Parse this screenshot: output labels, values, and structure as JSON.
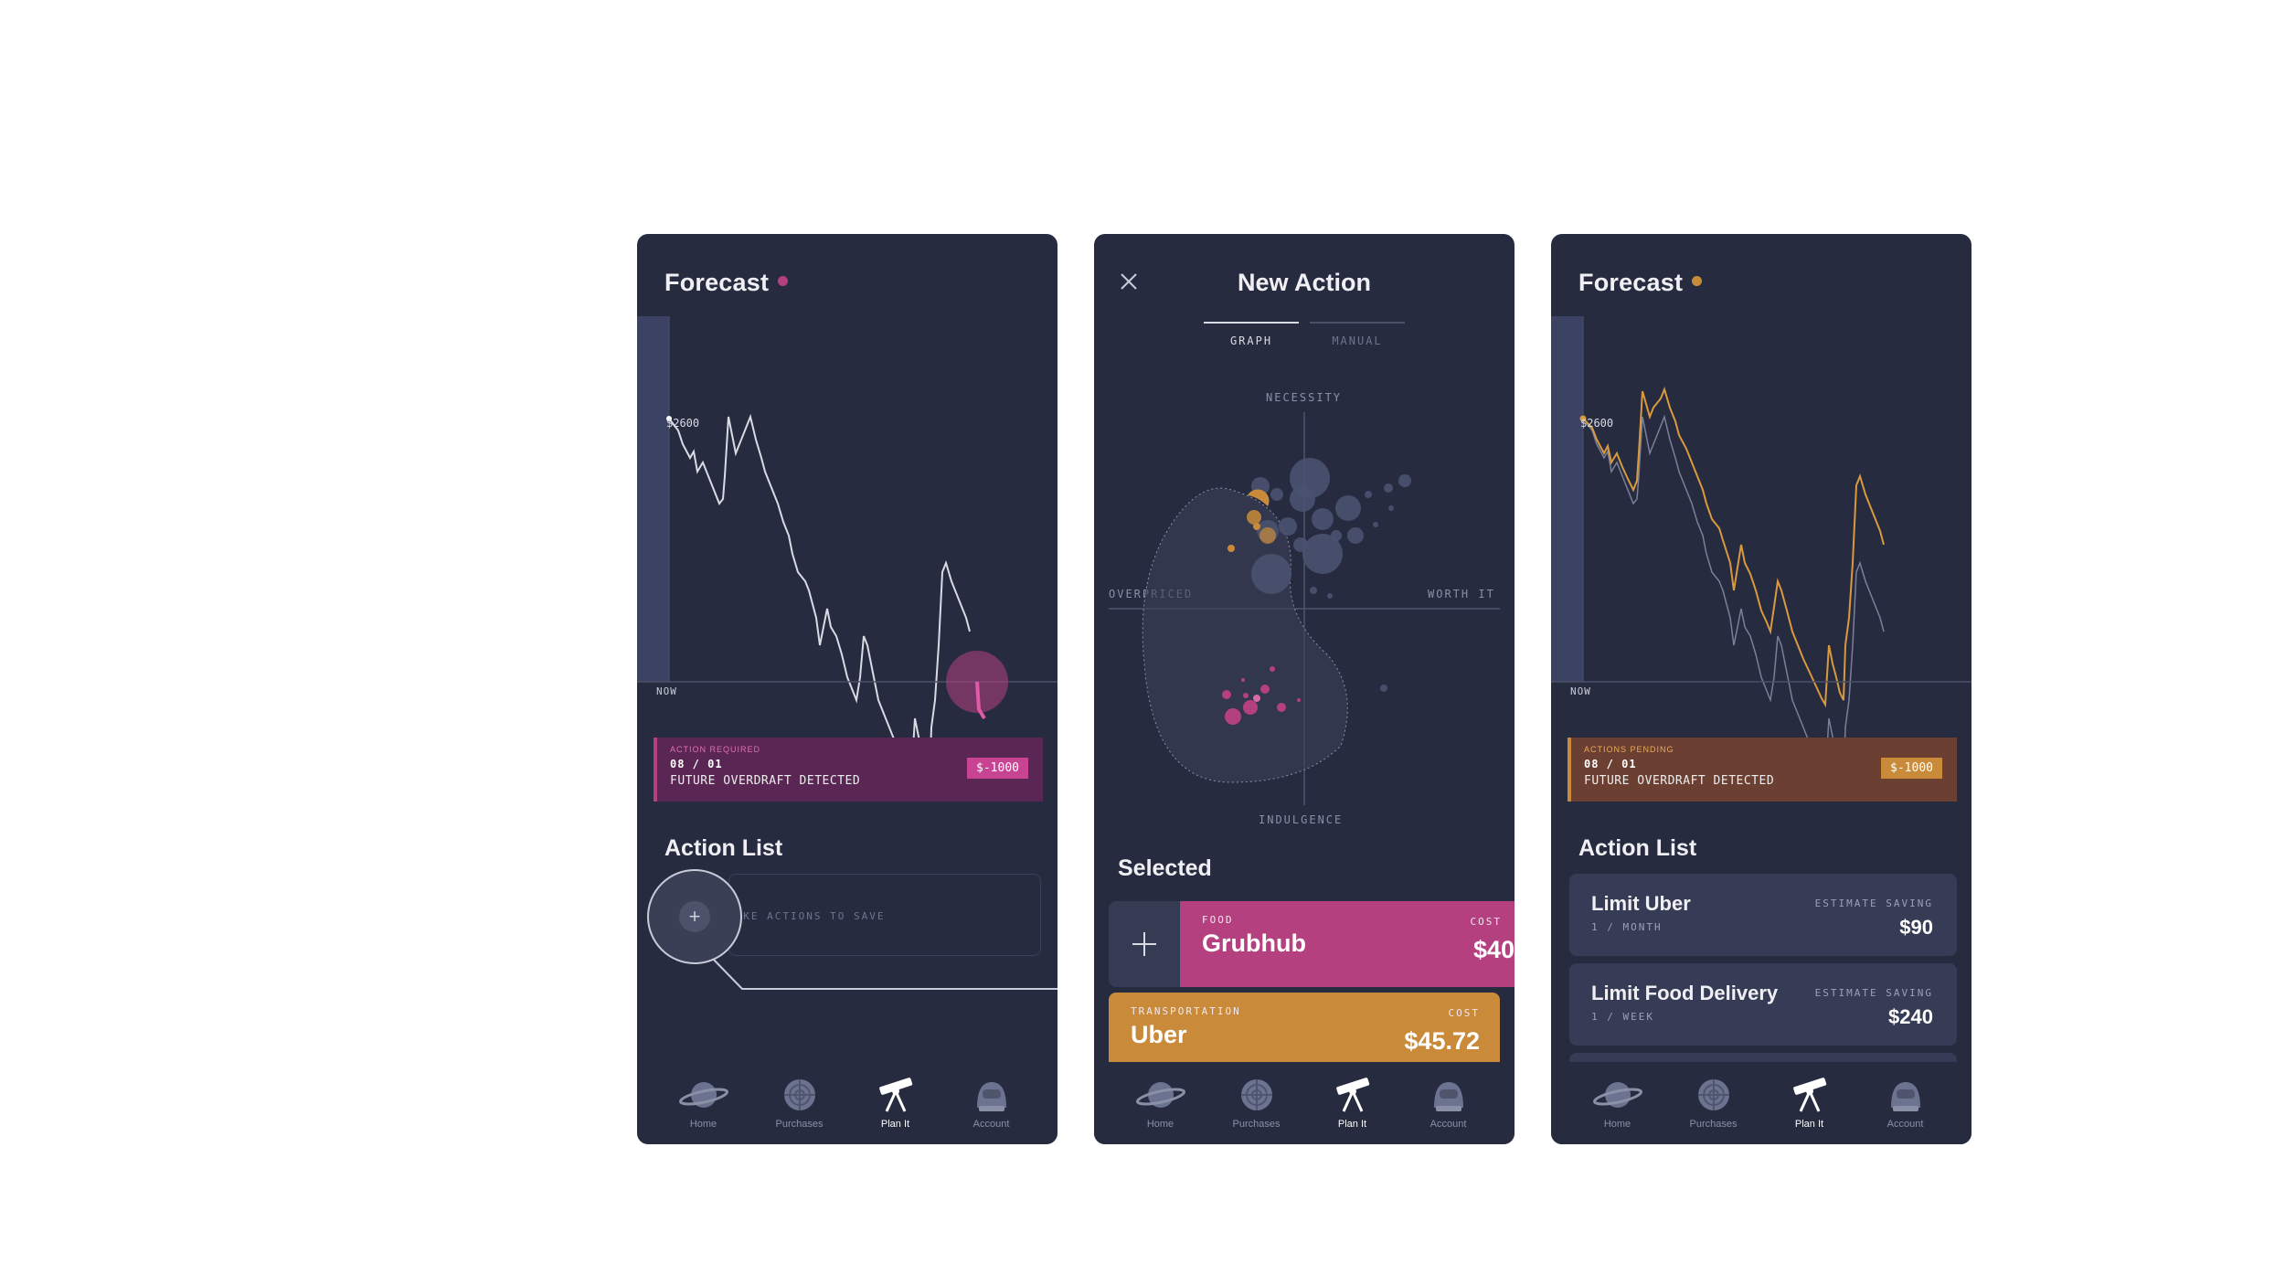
{
  "colors": {
    "bg": "#ffffff",
    "panel": "#262b40",
    "magenta": "#b5407f",
    "magenta_dark": "#5a2754",
    "orange": "#c98b3a",
    "orange_dark": "#6b4032",
    "line_grey": "#c8ccd8"
  },
  "screens": {
    "forecast_overdraft": {
      "title": "Forecast",
      "value_label": "$2600",
      "now_label": "NOW",
      "alert": {
        "caption": "ACTION REQUIRED",
        "date": "08 / 01",
        "message": "FUTURE OVERDRAFT DETECTED",
        "amount": "$-1000"
      },
      "section_title": "Action List",
      "empty_action_text": "TAKE ACTIONS TO SAVE",
      "add_icon": "plus-icon"
    },
    "new_action": {
      "title": "New Action",
      "tabs": [
        {
          "label": "GRAPH",
          "active": true
        },
        {
          "label": "MANUAL",
          "active": false
        }
      ],
      "axes": {
        "top": "NECESSITY",
        "bottom": "INDULGENCE",
        "left": "OVERPRICED",
        "right": "WORTH IT"
      },
      "selected_title": "Selected",
      "cards": [
        {
          "category": "FOOD",
          "name": "Grubhub",
          "cost_label": "COST",
          "cost": "$40"
        },
        {
          "category": "TRANSPORTATION",
          "name": "Uber",
          "cost_label": "COST",
          "cost": "$45.72"
        }
      ]
    },
    "forecast_pending": {
      "title": "Forecast",
      "value_label": "$2600",
      "now_label": "NOW",
      "alert": {
        "caption": "ACTIONS PENDING",
        "date": "08 / 01",
        "message": "FUTURE OVERDRAFT DETECTED",
        "amount": "$-1000"
      },
      "section_title": "Action List",
      "actions": [
        {
          "name": "Limit Uber",
          "frequency": "1 / MONTH",
          "saving_label": "ESTIMATE SAVING",
          "saving": "$90"
        },
        {
          "name": "Limit Food Delivery",
          "frequency": "1 / WEEK",
          "saving_label": "ESTIMATE SAVING",
          "saving": "$240"
        }
      ]
    }
  },
  "tabbar": [
    {
      "label": "Home",
      "icon": "planet-icon"
    },
    {
      "label": "Purchases",
      "icon": "target-globe-icon"
    },
    {
      "label": "Plan It",
      "icon": "telescope-icon",
      "active": true
    },
    {
      "label": "Account",
      "icon": "astronaut-helmet-icon"
    }
  ]
}
